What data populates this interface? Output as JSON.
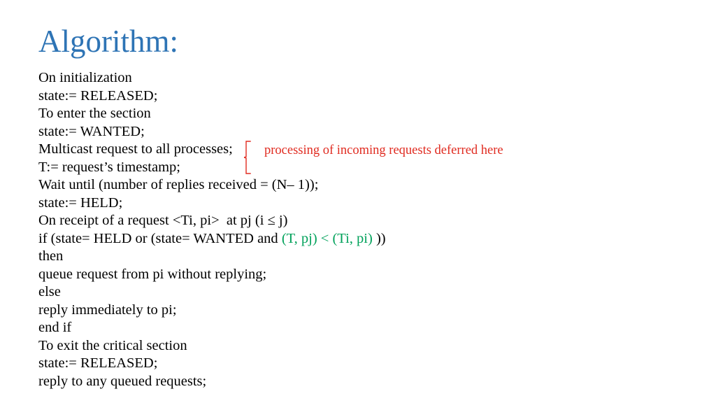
{
  "slide": {
    "title": "Algorithm:",
    "title_color": "#2E74B5",
    "background_color": "#FFFFFF",
    "body_text_color": "#000000"
  },
  "code": {
    "lines": [
      {
        "id": "line-on-initialization",
        "text": "On initialization"
      },
      {
        "id": "line-state-released-1",
        "text": "state:= RELEASED;"
      },
      {
        "id": "line-to-enter-section",
        "text": "To enter the section"
      },
      {
        "id": "line-state-wanted",
        "text": "state:= WANTED;"
      },
      {
        "id": "line-multicast-request",
        "text": "Multicast request to all processes;"
      },
      {
        "id": "line-timestamp",
        "text": "T:= request’s timestamp;"
      },
      {
        "id": "line-wait-until",
        "text": "Wait until (number of replies received = (N– 1));"
      },
      {
        "id": "line-state-held",
        "text": "state:= HELD;"
      },
      {
        "id": "line-on-receipt",
        "text": "On receipt of a request <Ti, pi>  at pj (i ≤ j)"
      },
      {
        "id": "line-if-condition",
        "text": "if (state= HELD or (state= WANTED and (T, pj) < (Ti, pi) ))"
      },
      {
        "id": "line-then",
        "text": "then"
      },
      {
        "id": "line-queue-request",
        "text": "queue request from pi without replying;"
      },
      {
        "id": "line-else",
        "text": "else"
      },
      {
        "id": "line-reply-immediately",
        "text": "reply immediately to pi;"
      },
      {
        "id": "line-end-if",
        "text": "end if"
      },
      {
        "id": "line-to-exit-section",
        "text": "To exit the critical section"
      },
      {
        "id": "line-state-released-2",
        "text": "state:= RELEASED;"
      },
      {
        "id": "line-reply-queued",
        "text": "reply to any queued requests;"
      }
    ],
    "if_line_parts": {
      "prefix": "if (state= HELD or (state= WANTED and ",
      "highlight": "(T, pj) < (Ti, pi)",
      "suffix": " ))",
      "highlight_color": "#00A15A"
    }
  },
  "annotation": {
    "text": "processing of incoming requests deferred here",
    "color": "#E02B20",
    "brace_color": "#E02B20",
    "brace_icon": "curly-brace-left-icon",
    "covers_lines": [
      "Multicast request to all processes;",
      "T:= request’s timestamp;"
    ]
  }
}
